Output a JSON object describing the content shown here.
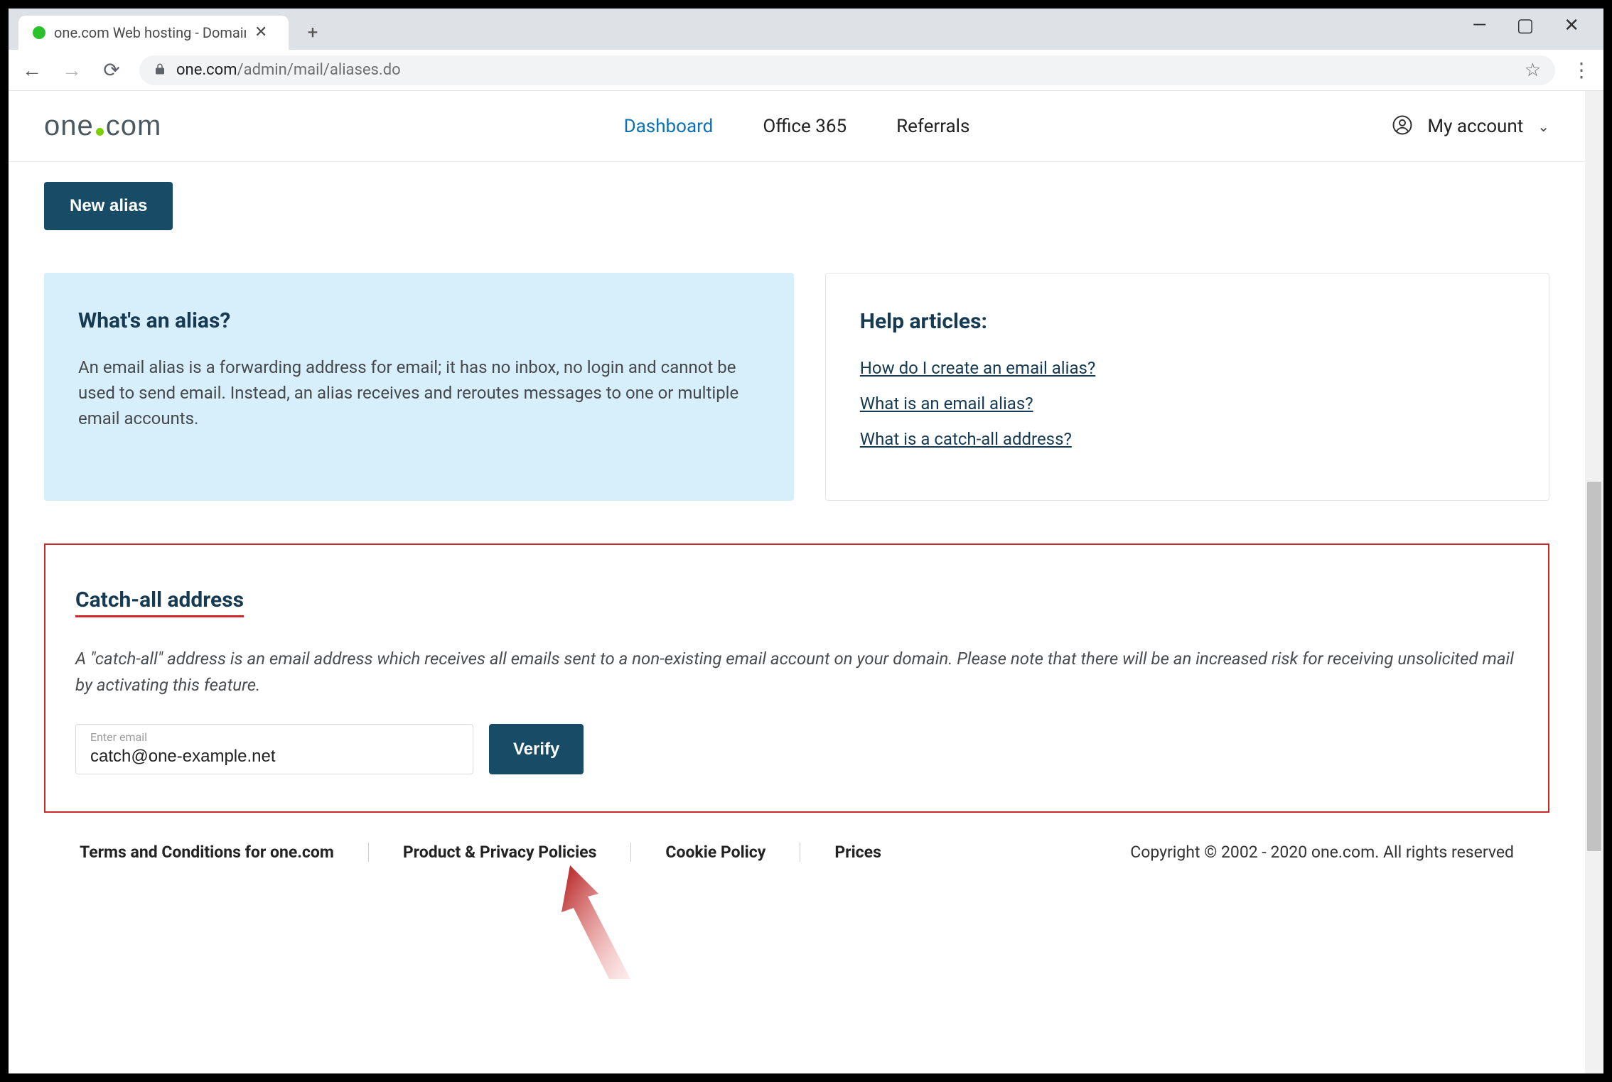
{
  "browser": {
    "tab_title": "one.com Web hosting  -  Domain",
    "url_domain": "one.com",
    "url_path": "/admin/mail/aliases.do"
  },
  "nav": {
    "dashboard": "Dashboard",
    "office365": "Office 365",
    "referrals": "Referrals",
    "account_label": "My account"
  },
  "buttons": {
    "new_alias": "New alias",
    "verify": "Verify"
  },
  "info": {
    "title": "What's an alias?",
    "body": "An email alias is a forwarding address for email; it has no inbox, no login and cannot be used to send email. Instead, an alias receives and reroutes messages to one or multiple email accounts."
  },
  "help": {
    "title": "Help articles:",
    "links": [
      "How do I create an email alias?",
      "What is an email alias?",
      "What is a catch-all address?"
    ]
  },
  "catchall": {
    "title": "Catch-all address",
    "desc": "A \"catch-all\" address is an email address which receives all emails sent to a non-existing email account on your domain. Please note that there will be an increased risk for receiving unsolicited mail by activating this feature.",
    "floating_label": "Enter email",
    "value": "catch@one-example.net"
  },
  "footer": {
    "terms": "Terms and Conditions for one.com",
    "privacy": "Product & Privacy Policies",
    "cookie": "Cookie Policy",
    "prices": "Prices",
    "copyright": "Copyright © 2002 - 2020 one.com. All rights reserved"
  }
}
